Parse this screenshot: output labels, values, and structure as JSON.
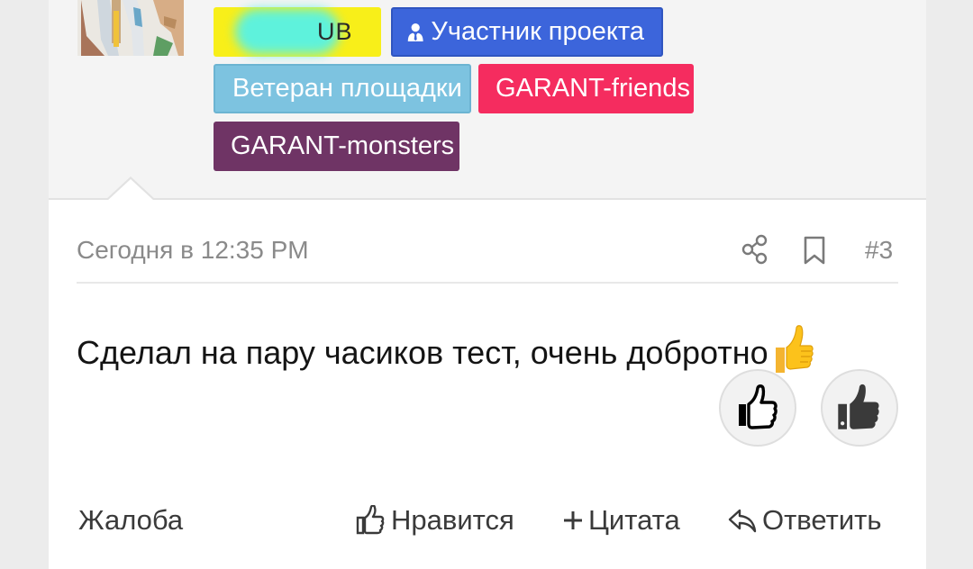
{
  "user": {
    "badges": [
      {
        "label": "V    CLUB_visible_part",
        "visible_text": "UB"
      },
      {
        "label": "Участник проекта"
      },
      {
        "label": "Ветеран площадки"
      },
      {
        "label": "GARANT-friends"
      },
      {
        "label": "GARANT-monsters"
      }
    ]
  },
  "post": {
    "date": "Сегодня в 12:35 PM",
    "number": "#3",
    "message": "Сделал на пару часиков тест, очень добротно"
  },
  "actions": {
    "report": "Жалоба",
    "like": "Нравится",
    "quote": "Цитата",
    "reply": "Ответить"
  },
  "colors": {
    "badge_club": "#f8ef19",
    "badge_member": "#3c65db",
    "badge_veteran": "#7dc3e0",
    "badge_friends": "#f52c5f",
    "badge_monsters": "#6f3465"
  }
}
